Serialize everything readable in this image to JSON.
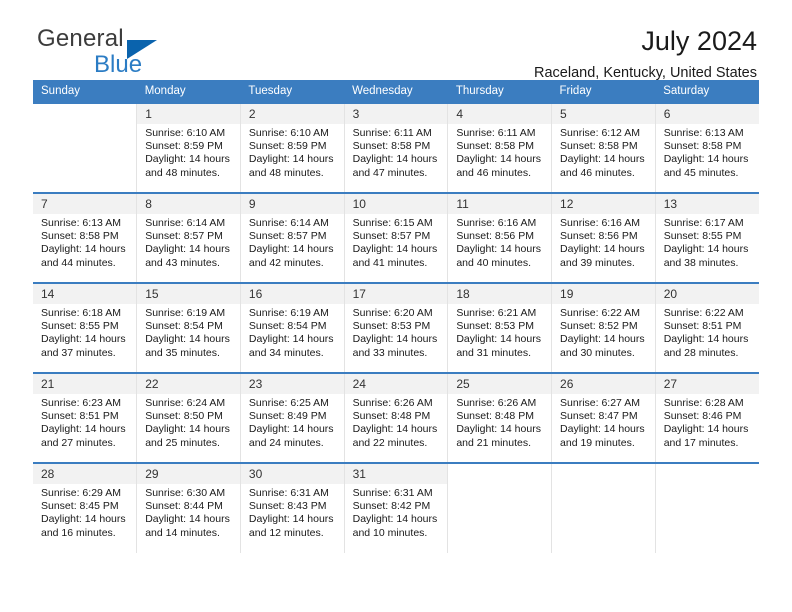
{
  "brand": {
    "name_part1": "General",
    "name_part2": "Blue",
    "logo_icon": "triangle-logo-icon",
    "colors": {
      "general": "#3c3c3c",
      "blue": "#2b7cc4",
      "triangle": "#0a63ad"
    }
  },
  "header": {
    "title": "July 2024",
    "subtitle": "Raceland, Kentucky, United States"
  },
  "theme": {
    "header_bg": "#3b7dc0",
    "row_divider": "#3b7dc0",
    "daynum_bg": "#f2f2f2",
    "alt_row_bg": "#fbfbfb",
    "text": "#1a1a1a"
  },
  "weekdays": [
    "Sunday",
    "Monday",
    "Tuesday",
    "Wednesday",
    "Thursday",
    "Friday",
    "Saturday"
  ],
  "weeks": [
    [
      {
        "day": "",
        "sunrise": "",
        "sunset": "",
        "daylight1": "",
        "daylight2": ""
      },
      {
        "day": "1",
        "sunrise": "Sunrise: 6:10 AM",
        "sunset": "Sunset: 8:59 PM",
        "daylight1": "Daylight: 14 hours",
        "daylight2": "and 48 minutes."
      },
      {
        "day": "2",
        "sunrise": "Sunrise: 6:10 AM",
        "sunset": "Sunset: 8:59 PM",
        "daylight1": "Daylight: 14 hours",
        "daylight2": "and 48 minutes."
      },
      {
        "day": "3",
        "sunrise": "Sunrise: 6:11 AM",
        "sunset": "Sunset: 8:58 PM",
        "daylight1": "Daylight: 14 hours",
        "daylight2": "and 47 minutes."
      },
      {
        "day": "4",
        "sunrise": "Sunrise: 6:11 AM",
        "sunset": "Sunset: 8:58 PM",
        "daylight1": "Daylight: 14 hours",
        "daylight2": "and 46 minutes."
      },
      {
        "day": "5",
        "sunrise": "Sunrise: 6:12 AM",
        "sunset": "Sunset: 8:58 PM",
        "daylight1": "Daylight: 14 hours",
        "daylight2": "and 46 minutes."
      },
      {
        "day": "6",
        "sunrise": "Sunrise: 6:13 AM",
        "sunset": "Sunset: 8:58 PM",
        "daylight1": "Daylight: 14 hours",
        "daylight2": "and 45 minutes."
      }
    ],
    [
      {
        "day": "7",
        "sunrise": "Sunrise: 6:13 AM",
        "sunset": "Sunset: 8:58 PM",
        "daylight1": "Daylight: 14 hours",
        "daylight2": "and 44 minutes."
      },
      {
        "day": "8",
        "sunrise": "Sunrise: 6:14 AM",
        "sunset": "Sunset: 8:57 PM",
        "daylight1": "Daylight: 14 hours",
        "daylight2": "and 43 minutes."
      },
      {
        "day": "9",
        "sunrise": "Sunrise: 6:14 AM",
        "sunset": "Sunset: 8:57 PM",
        "daylight1": "Daylight: 14 hours",
        "daylight2": "and 42 minutes."
      },
      {
        "day": "10",
        "sunrise": "Sunrise: 6:15 AM",
        "sunset": "Sunset: 8:57 PM",
        "daylight1": "Daylight: 14 hours",
        "daylight2": "and 41 minutes."
      },
      {
        "day": "11",
        "sunrise": "Sunrise: 6:16 AM",
        "sunset": "Sunset: 8:56 PM",
        "daylight1": "Daylight: 14 hours",
        "daylight2": "and 40 minutes."
      },
      {
        "day": "12",
        "sunrise": "Sunrise: 6:16 AM",
        "sunset": "Sunset: 8:56 PM",
        "daylight1": "Daylight: 14 hours",
        "daylight2": "and 39 minutes."
      },
      {
        "day": "13",
        "sunrise": "Sunrise: 6:17 AM",
        "sunset": "Sunset: 8:55 PM",
        "daylight1": "Daylight: 14 hours",
        "daylight2": "and 38 minutes."
      }
    ],
    [
      {
        "day": "14",
        "sunrise": "Sunrise: 6:18 AM",
        "sunset": "Sunset: 8:55 PM",
        "daylight1": "Daylight: 14 hours",
        "daylight2": "and 37 minutes."
      },
      {
        "day": "15",
        "sunrise": "Sunrise: 6:19 AM",
        "sunset": "Sunset: 8:54 PM",
        "daylight1": "Daylight: 14 hours",
        "daylight2": "and 35 minutes."
      },
      {
        "day": "16",
        "sunrise": "Sunrise: 6:19 AM",
        "sunset": "Sunset: 8:54 PM",
        "daylight1": "Daylight: 14 hours",
        "daylight2": "and 34 minutes."
      },
      {
        "day": "17",
        "sunrise": "Sunrise: 6:20 AM",
        "sunset": "Sunset: 8:53 PM",
        "daylight1": "Daylight: 14 hours",
        "daylight2": "and 33 minutes."
      },
      {
        "day": "18",
        "sunrise": "Sunrise: 6:21 AM",
        "sunset": "Sunset: 8:53 PM",
        "daylight1": "Daylight: 14 hours",
        "daylight2": "and 31 minutes."
      },
      {
        "day": "19",
        "sunrise": "Sunrise: 6:22 AM",
        "sunset": "Sunset: 8:52 PM",
        "daylight1": "Daylight: 14 hours",
        "daylight2": "and 30 minutes."
      },
      {
        "day": "20",
        "sunrise": "Sunrise: 6:22 AM",
        "sunset": "Sunset: 8:51 PM",
        "daylight1": "Daylight: 14 hours",
        "daylight2": "and 28 minutes."
      }
    ],
    [
      {
        "day": "21",
        "sunrise": "Sunrise: 6:23 AM",
        "sunset": "Sunset: 8:51 PM",
        "daylight1": "Daylight: 14 hours",
        "daylight2": "and 27 minutes."
      },
      {
        "day": "22",
        "sunrise": "Sunrise: 6:24 AM",
        "sunset": "Sunset: 8:50 PM",
        "daylight1": "Daylight: 14 hours",
        "daylight2": "and 25 minutes."
      },
      {
        "day": "23",
        "sunrise": "Sunrise: 6:25 AM",
        "sunset": "Sunset: 8:49 PM",
        "daylight1": "Daylight: 14 hours",
        "daylight2": "and 24 minutes."
      },
      {
        "day": "24",
        "sunrise": "Sunrise: 6:26 AM",
        "sunset": "Sunset: 8:48 PM",
        "daylight1": "Daylight: 14 hours",
        "daylight2": "and 22 minutes."
      },
      {
        "day": "25",
        "sunrise": "Sunrise: 6:26 AM",
        "sunset": "Sunset: 8:48 PM",
        "daylight1": "Daylight: 14 hours",
        "daylight2": "and 21 minutes."
      },
      {
        "day": "26",
        "sunrise": "Sunrise: 6:27 AM",
        "sunset": "Sunset: 8:47 PM",
        "daylight1": "Daylight: 14 hours",
        "daylight2": "and 19 minutes."
      },
      {
        "day": "27",
        "sunrise": "Sunrise: 6:28 AM",
        "sunset": "Sunset: 8:46 PM",
        "daylight1": "Daylight: 14 hours",
        "daylight2": "and 17 minutes."
      }
    ],
    [
      {
        "day": "28",
        "sunrise": "Sunrise: 6:29 AM",
        "sunset": "Sunset: 8:45 PM",
        "daylight1": "Daylight: 14 hours",
        "daylight2": "and 16 minutes."
      },
      {
        "day": "29",
        "sunrise": "Sunrise: 6:30 AM",
        "sunset": "Sunset: 8:44 PM",
        "daylight1": "Daylight: 14 hours",
        "daylight2": "and 14 minutes."
      },
      {
        "day": "30",
        "sunrise": "Sunrise: 6:31 AM",
        "sunset": "Sunset: 8:43 PM",
        "daylight1": "Daylight: 14 hours",
        "daylight2": "and 12 minutes."
      },
      {
        "day": "31",
        "sunrise": "Sunrise: 6:31 AM",
        "sunset": "Sunset: 8:42 PM",
        "daylight1": "Daylight: 14 hours",
        "daylight2": "and 10 minutes."
      },
      {
        "day": "",
        "sunrise": "",
        "sunset": "",
        "daylight1": "",
        "daylight2": ""
      },
      {
        "day": "",
        "sunrise": "",
        "sunset": "",
        "daylight1": "",
        "daylight2": ""
      },
      {
        "day": "",
        "sunrise": "",
        "sunset": "",
        "daylight1": "",
        "daylight2": ""
      }
    ]
  ]
}
